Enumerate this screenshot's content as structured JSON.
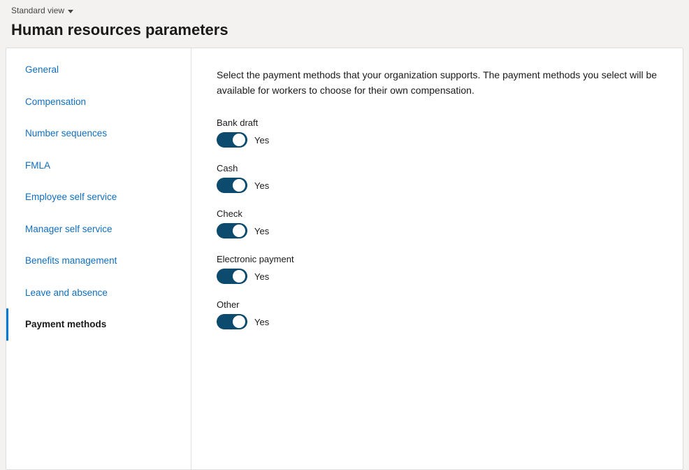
{
  "topbar": {
    "standard_view_label": "Standard view"
  },
  "page": {
    "title": "Human resources parameters"
  },
  "sidebar": {
    "items": [
      {
        "id": "general",
        "label": "General",
        "active": false
      },
      {
        "id": "compensation",
        "label": "Compensation",
        "active": false
      },
      {
        "id": "number-sequences",
        "label": "Number sequences",
        "active": false
      },
      {
        "id": "fmla",
        "label": "FMLA",
        "active": false
      },
      {
        "id": "employee-self-service",
        "label": "Employee self service",
        "active": false
      },
      {
        "id": "manager-self-service",
        "label": "Manager self service",
        "active": false
      },
      {
        "id": "benefits-management",
        "label": "Benefits management",
        "active": false
      },
      {
        "id": "leave-and-absence",
        "label": "Leave and absence",
        "active": false
      },
      {
        "id": "payment-methods",
        "label": "Payment methods",
        "active": true
      }
    ]
  },
  "main": {
    "description": "Select the payment methods that your organization supports. The payment methods you select will be available for workers to choose for their own compensation.",
    "methods": [
      {
        "id": "bank-draft",
        "label": "Bank draft",
        "toggle_state": "Yes",
        "enabled": true
      },
      {
        "id": "cash",
        "label": "Cash",
        "toggle_state": "Yes",
        "enabled": true
      },
      {
        "id": "check",
        "label": "Check",
        "toggle_state": "Yes",
        "enabled": true
      },
      {
        "id": "electronic-payment",
        "label": "Electronic payment",
        "toggle_state": "Yes",
        "enabled": true
      },
      {
        "id": "other",
        "label": "Other",
        "toggle_state": "Yes",
        "enabled": true
      }
    ]
  }
}
